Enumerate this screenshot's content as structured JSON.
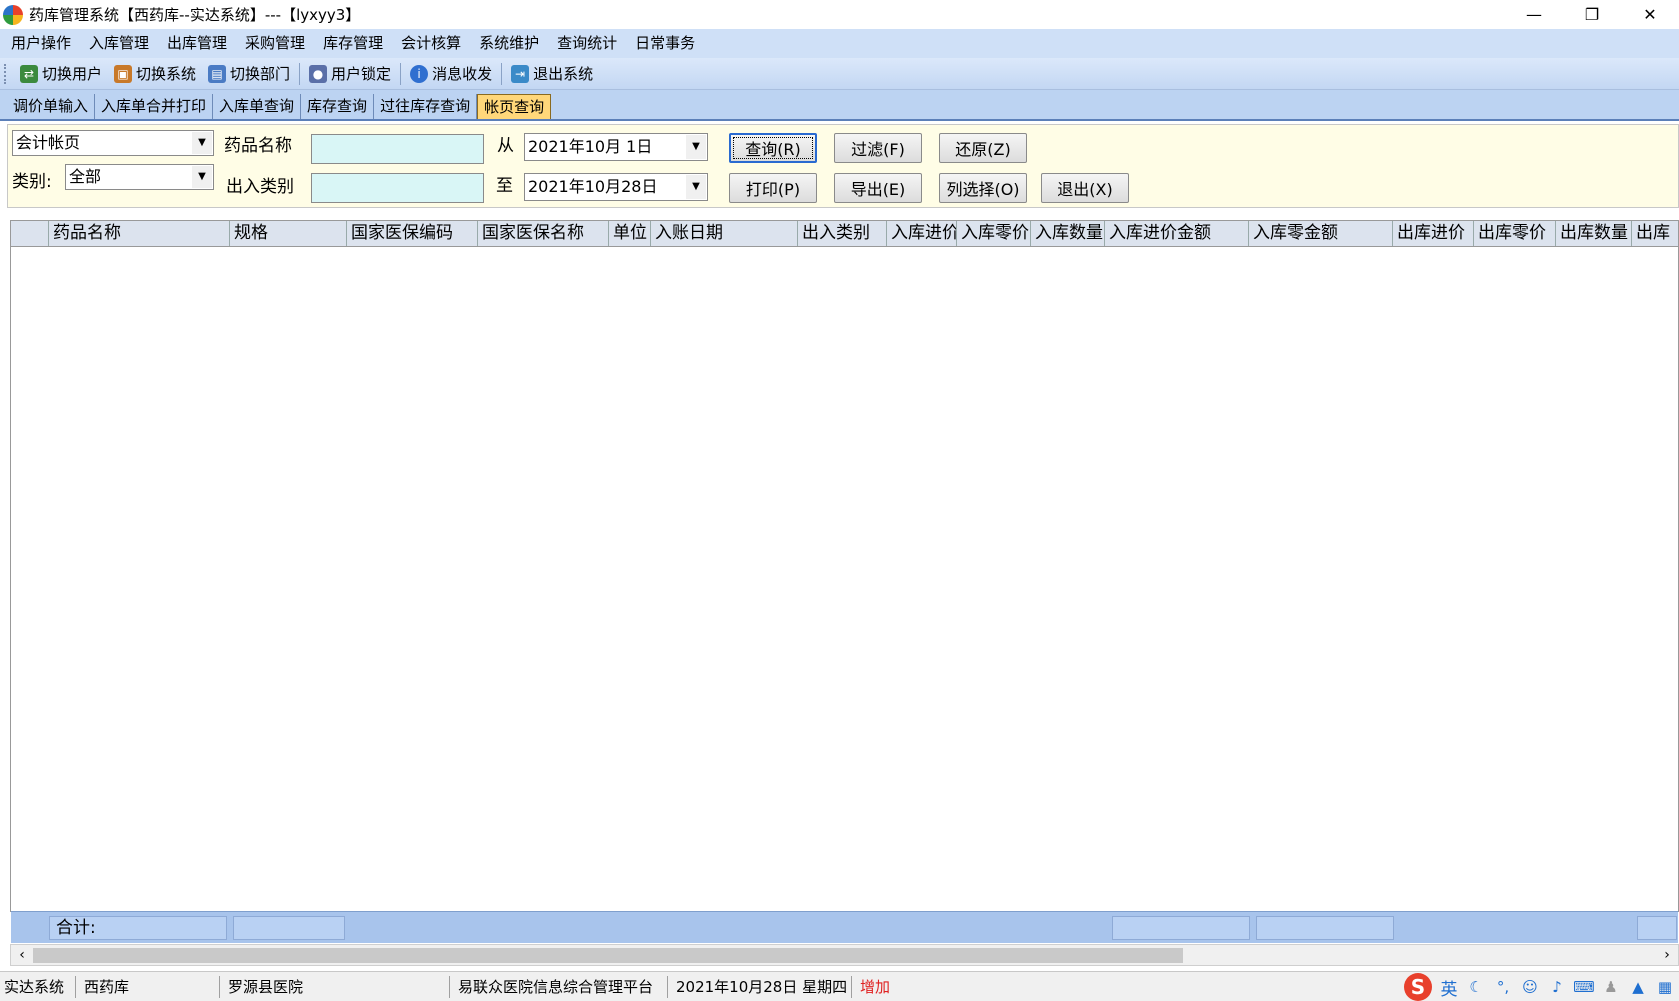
{
  "window": {
    "title": "药库管理系统【西药库--实达系统】---【lyxyy3】",
    "minimize": "—",
    "restore": "❐",
    "close": "✕"
  },
  "menu": [
    "用户操作",
    "入库管理",
    "出库管理",
    "采购管理",
    "库存管理",
    "会计核算",
    "系统维护",
    "查询统计",
    "日常事务"
  ],
  "toolbar": [
    {
      "label": "切换用户",
      "icon": "switch-user-icon",
      "color": "#3b8a3e"
    },
    {
      "label": "切换系统",
      "icon": "switch-system-icon",
      "color": "#c8792a"
    },
    {
      "label": "切换部门",
      "icon": "switch-department-icon",
      "color": "#4a7bc4"
    },
    {
      "label": "用户锁定",
      "icon": "user-lock-icon",
      "color": "#5a6fa8"
    },
    {
      "label": "消息收发",
      "icon": "message-icon",
      "color": "#2f6fd0"
    },
    {
      "label": "退出系统",
      "icon": "exit-icon",
      "color": "#3a8ac8"
    }
  ],
  "tabs": [
    "调价单输入",
    "入库单合并打印",
    "入库单查询",
    "库存查询",
    "过往库存查询",
    "帐页查询"
  ],
  "active_tab": "帐页查询",
  "filter": {
    "ledger_select": "会计帐页",
    "drug_name_label": "药品名称",
    "drug_name_value": "",
    "from_label": "从",
    "date_from": "2021年10月 1日",
    "category_label": "类别:",
    "category_select": "全部",
    "inout_type_label": "出入类别",
    "inout_type_value": "",
    "to_label": "至",
    "date_to": "2021年10月28日"
  },
  "buttons": {
    "query": "查询(R)",
    "filter": "过滤(F)",
    "restore": "还原(Z)",
    "print": "打印(P)",
    "export": "导出(E)",
    "columns": "列选择(O)",
    "exit": "退出(X)"
  },
  "grid": {
    "columns": [
      "药品名称",
      "规格",
      "国家医保编码",
      "国家医保名称",
      "单位",
      "入账日期",
      "出入类别",
      "入库进价",
      "入库零价",
      "入库数量",
      "入库进价金额",
      "入库零金额",
      "出库进价",
      "出库零价",
      "出库数量",
      "出库"
    ],
    "rows": [],
    "footer_total_label": "合计:"
  },
  "statusbar": {
    "system": "实达系统",
    "department": "西药库",
    "hospital": "罗源县医院",
    "platform": "易联众医院信息综合管理平台",
    "datetime": "2021年10月28日  星期四",
    "mode": "增加",
    "mode_color": "#e02020"
  },
  "tray": {
    "ime_logo": "S",
    "ime_lang": "英"
  }
}
